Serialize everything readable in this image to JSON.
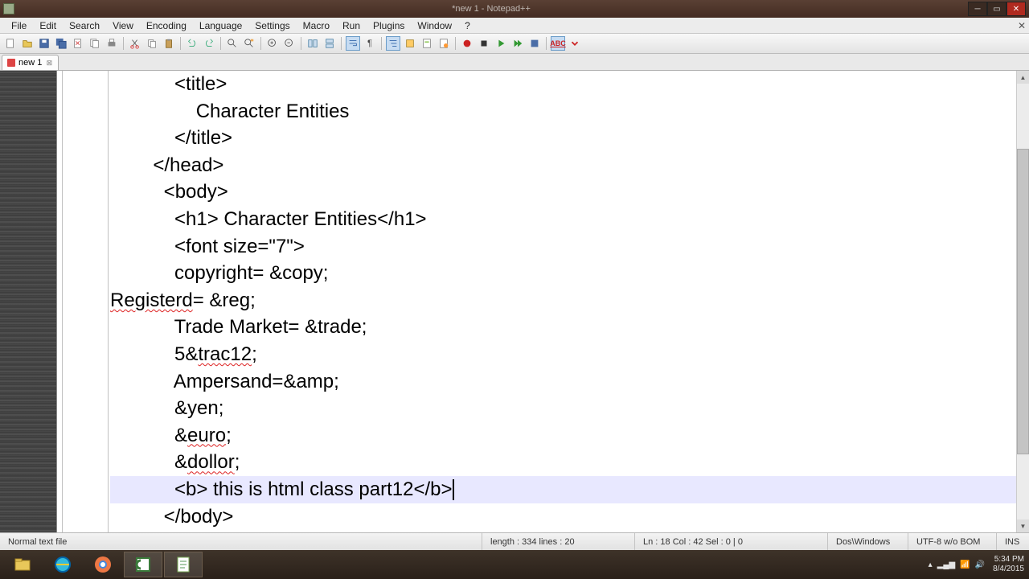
{
  "window": {
    "title": "*new 1 - Notepad++"
  },
  "menus": [
    "File",
    "Edit",
    "Search",
    "View",
    "Encoding",
    "Language",
    "Settings",
    "Macro",
    "Run",
    "Plugins",
    "Window",
    "?"
  ],
  "tab": {
    "label": "new 1"
  },
  "code_lines": [
    "            <title>",
    "                Character Entities",
    "            </title>",
    "        </head>",
    "          <body>",
    "            <h1> Character Entities</h1>",
    "            <font size=\"7\">",
    "            copyright= &copy;",
    "            Registerd= &reg;",
    "            Trade Market= &trade;",
    "            5&trac12;",
    "            Ampersand=&amp;",
    "            &yen;",
    "            &euro;",
    "            &dollor;",
    "            <b> this is html class part12</b>",
    "          </body>"
  ],
  "highlight_line_index": 15,
  "status": {
    "filetype": "Normal text file",
    "length": "length : 334    lines : 20",
    "pos": "Ln : 18    Col : 42    Sel : 0 | 0",
    "eol": "Dos\\Windows",
    "encoding": "UTF-8 w/o BOM",
    "mode": "INS"
  },
  "tray": {
    "time": "5:34 PM",
    "date": "8/4/2015"
  }
}
